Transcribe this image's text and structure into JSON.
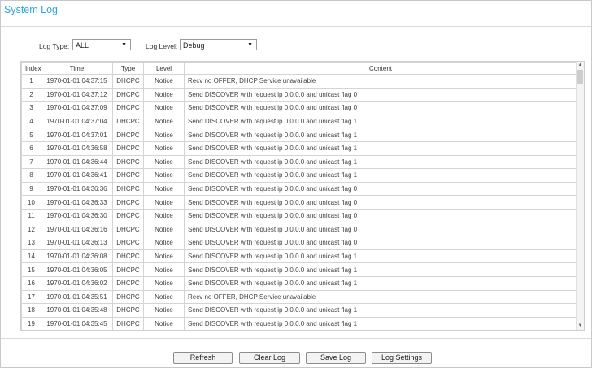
{
  "page": {
    "title": "System Log"
  },
  "filters": {
    "log_type_label": "Log Type:",
    "log_type_value": "ALL",
    "log_level_label": "Log Level:",
    "log_level_value": "Debug"
  },
  "table": {
    "columns": [
      "Index",
      "Time",
      "Type",
      "Level",
      "Content"
    ],
    "rows": [
      [
        "1",
        "1970-01-01 04:37:15",
        "DHCPC",
        "Notice",
        "Recv no OFFER, DHCP Service unavailable"
      ],
      [
        "2",
        "1970-01-01 04:37:12",
        "DHCPC",
        "Notice",
        "Send DISCOVER with request ip 0.0.0.0 and unicast flag 0"
      ],
      [
        "3",
        "1970-01-01 04:37:09",
        "DHCPC",
        "Notice",
        "Send DISCOVER with request ip 0.0.0.0 and unicast flag 0"
      ],
      [
        "4",
        "1970-01-01 04:37:04",
        "DHCPC",
        "Notice",
        "Send DISCOVER with request ip 0.0.0.0 and unicast flag 1"
      ],
      [
        "5",
        "1970-01-01 04:37:01",
        "DHCPC",
        "Notice",
        "Send DISCOVER with request ip 0.0.0.0 and unicast flag 1"
      ],
      [
        "6",
        "1970-01-01 04:36:58",
        "DHCPC",
        "Notice",
        "Send DISCOVER with request ip 0.0.0.0 and unicast flag 1"
      ],
      [
        "7",
        "1970-01-01 04:36:44",
        "DHCPC",
        "Notice",
        "Send DISCOVER with request ip 0.0.0.0 and unicast flag 1"
      ],
      [
        "8",
        "1970-01-01 04:36:41",
        "DHCPC",
        "Notice",
        "Send DISCOVER with request ip 0.0.0.0 and unicast flag 1"
      ],
      [
        "9",
        "1970-01-01 04:36:36",
        "DHCPC",
        "Notice",
        "Send DISCOVER with request ip 0.0.0.0 and unicast flag 0"
      ],
      [
        "10",
        "1970-01-01 04:36:33",
        "DHCPC",
        "Notice",
        "Send DISCOVER with request ip 0.0.0.0 and unicast flag 0"
      ],
      [
        "11",
        "1970-01-01 04:36:30",
        "DHCPC",
        "Notice",
        "Send DISCOVER with request ip 0.0.0.0 and unicast flag 0"
      ],
      [
        "12",
        "1970-01-01 04:36:16",
        "DHCPC",
        "Notice",
        "Send DISCOVER with request ip 0.0.0.0 and unicast flag 0"
      ],
      [
        "13",
        "1970-01-01 04:36:13",
        "DHCPC",
        "Notice",
        "Send DISCOVER with request ip 0.0.0.0 and unicast flag 0"
      ],
      [
        "14",
        "1970-01-01 04:36:08",
        "DHCPC",
        "Notice",
        "Send DISCOVER with request ip 0.0.0.0 and unicast flag 1"
      ],
      [
        "15",
        "1970-01-01 04:36:05",
        "DHCPC",
        "Notice",
        "Send DISCOVER with request ip 0.0.0.0 and unicast flag 1"
      ],
      [
        "16",
        "1970-01-01 04:36:02",
        "DHCPC",
        "Notice",
        "Send DISCOVER with request ip 0.0.0.0 and unicast flag 1"
      ],
      [
        "17",
        "1970-01-01 04:35:51",
        "DHCPC",
        "Notice",
        "Recv no OFFER, DHCP Service unavailable"
      ],
      [
        "18",
        "1970-01-01 04:35:48",
        "DHCPC",
        "Notice",
        "Send DISCOVER with request ip 0.0.0.0 and unicast flag 1"
      ],
      [
        "19",
        "1970-01-01 04:35:45",
        "DHCPC",
        "Notice",
        "Send DISCOVER with request ip 0.0.0.0 and unicast flag 1"
      ]
    ]
  },
  "buttons": {
    "refresh": "Refresh",
    "clear_log": "Clear Log",
    "save_log": "Save Log",
    "log_settings": "Log Settings"
  },
  "colors": {
    "accent": "#2fa7dc",
    "border": "#d4d4d4"
  },
  "icons": {
    "dropdown": "chevron-down-icon",
    "scroll_up": "scroll-up-arrow-icon",
    "scroll_down": "scroll-down-arrow-icon"
  }
}
